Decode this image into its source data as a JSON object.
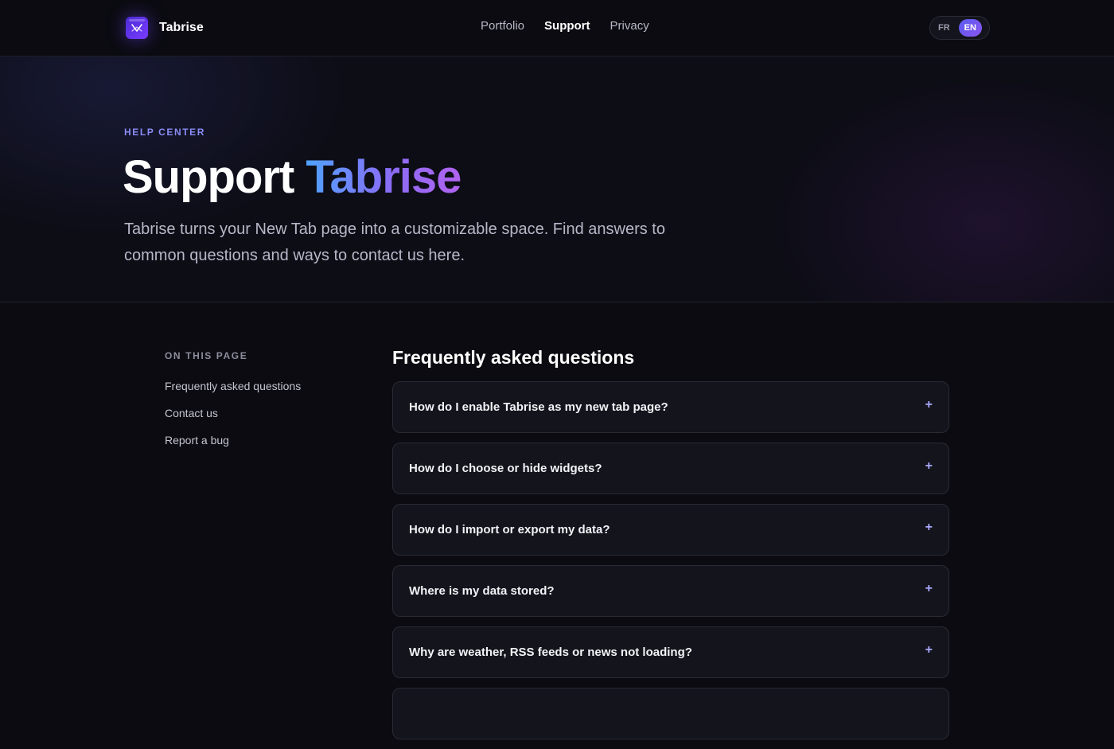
{
  "brand": {
    "name": "Tabrise",
    "logo_icon": "tabrise-logo-icon"
  },
  "nav": {
    "items": [
      {
        "label": "Portfolio",
        "active": false
      },
      {
        "label": "Support",
        "active": true
      },
      {
        "label": "Privacy",
        "active": false
      }
    ]
  },
  "language": {
    "options": [
      "FR",
      "EN"
    ],
    "selected": "EN"
  },
  "hero": {
    "eyebrow": "HELP CENTER",
    "title_plain": "Support",
    "title_accent": "Tabrise",
    "description": "Tabrise turns your New Tab page into a customizable space. Find answers to common questions and ways to contact us here."
  },
  "toc": {
    "title": "ON THIS PAGE",
    "links": [
      "Frequently asked questions",
      "Contact us",
      "Report a bug"
    ]
  },
  "faq": {
    "title": "Frequently asked questions",
    "items": [
      {
        "question": "How do I enable Tabrise as my new tab page?",
        "icon": "plus-icon"
      },
      {
        "question": "How do I choose or hide widgets?",
        "icon": "plus-icon"
      },
      {
        "question": "How do I import or export my data?",
        "icon": "plus-icon"
      },
      {
        "question": "Where is my data stored?",
        "icon": "plus-icon"
      },
      {
        "question": "Why are weather, RSS feeds or news not loading?",
        "icon": "plus-icon"
      }
    ],
    "expand_symbol": "+"
  },
  "colors": {
    "background": "#0b0b11",
    "accent": "#8a8cf5",
    "gradient_start": "#4fa3ff",
    "gradient_end": "#b163f0"
  }
}
